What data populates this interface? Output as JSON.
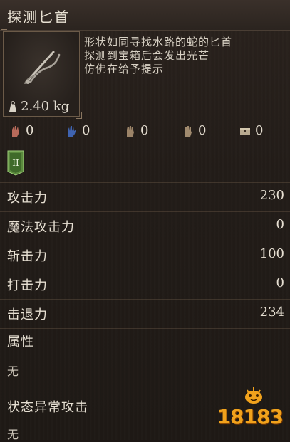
{
  "item": {
    "name": "探测匕首",
    "weight": "2.40 kg",
    "description_lines": [
      "形状如同寻找水路的蛇的匕首",
      "探测到宝箱后会发出光芒",
      "仿佛在给予提示"
    ],
    "damage_types": [
      {
        "icon": "red-hand-icon",
        "color": "#b86a5a",
        "value": "0"
      },
      {
        "icon": "blue-hand-icon",
        "color": "#3f63b0",
        "value": "0"
      },
      {
        "icon": "brown-hand-icon",
        "color": "#9c8468",
        "value": "0"
      },
      {
        "icon": "tan-hand-icon",
        "color": "#a08a6e",
        "value": "0"
      },
      {
        "icon": "chest-icon",
        "color": "#b8aa90",
        "value": "0"
      }
    ],
    "badge_icon": "green-rank-badge-icon",
    "stats": [
      {
        "label": "攻击力",
        "value": "230"
      },
      {
        "label": "魔法攻击力",
        "value": "0"
      },
      {
        "label": "斩击力",
        "value": "100"
      },
      {
        "label": "打击力",
        "value": "0"
      },
      {
        "label": "击退力",
        "value": "234"
      }
    ],
    "attribute": {
      "label": "属性",
      "value": "无"
    },
    "status_attack": {
      "label": "状态异常攻击",
      "value": "无"
    }
  },
  "watermark": {
    "text": "18183"
  }
}
